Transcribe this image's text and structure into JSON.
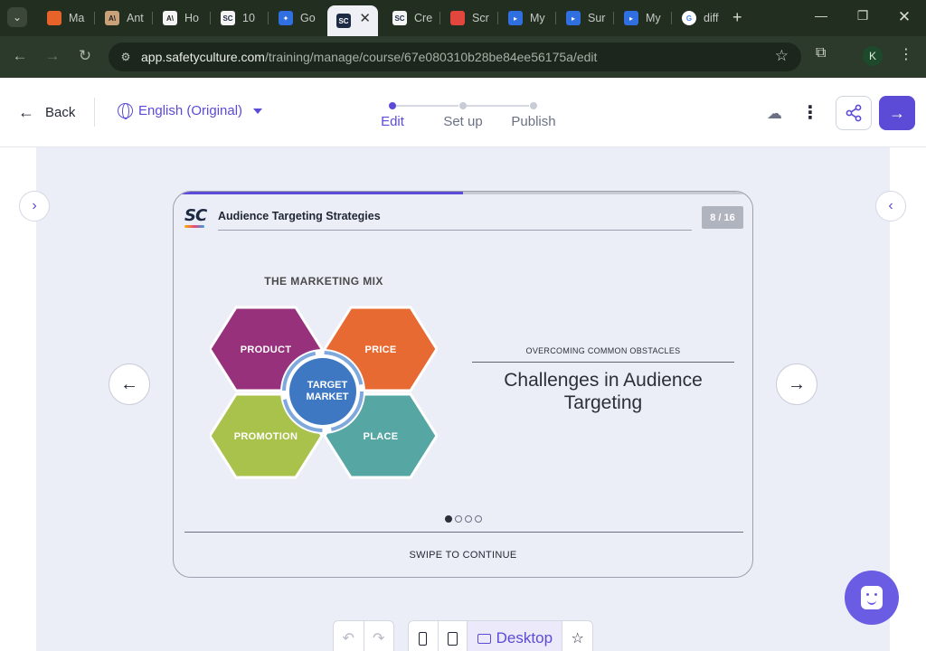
{
  "browser": {
    "tabs": [
      {
        "label": "Ma",
        "favicon": "orange-grid-icon",
        "color": "#e8632a"
      },
      {
        "label": "Ant",
        "favicon": "anthropic-icon",
        "color": "#c9a27a"
      },
      {
        "label": "Ho",
        "favicon": "anthropic-dark-icon",
        "color": "#2b2b2b"
      },
      {
        "label": "10",
        "favicon": "safetyculture-icon",
        "color": "#1c2a44"
      },
      {
        "label": "Go",
        "favicon": "butterfly-icon",
        "color": "#2f6fe0"
      },
      {
        "label": "",
        "favicon": "safetyculture-icon",
        "color": "#1c2a44"
      },
      {
        "label": "Cre",
        "favicon": "safetyculture-icon",
        "color": "#1c2a44"
      },
      {
        "label": "Scr",
        "favicon": "image-icon",
        "color": "#e3463c"
      },
      {
        "label": "My",
        "favicon": "chat-icon",
        "color": "#2f6fe0"
      },
      {
        "label": "Sur",
        "favicon": "chat-icon",
        "color": "#2f6fe0"
      },
      {
        "label": "My",
        "favicon": "chat-icon",
        "color": "#2f6fe0"
      },
      {
        "label": "diff",
        "favicon": "google-icon",
        "color": "#ffffff"
      }
    ],
    "url_host": "app.safetyculture.com",
    "url_path": "/training/manage/course/67e080310b28be84ee56175a/edit",
    "profile_initial": "K"
  },
  "header": {
    "back_label": "Back",
    "language": "English (Original)",
    "steps": [
      {
        "label": "Edit",
        "active": true
      },
      {
        "label": "Set up",
        "active": false
      },
      {
        "label": "Publish",
        "active": false
      }
    ],
    "accent_color": "#5b4bd6"
  },
  "slide": {
    "logo": "SC",
    "course_title": "Audience Targeting Strategies",
    "page": "8 / 16",
    "progress_fraction": 0.5,
    "image": {
      "title": "THE MARKETING MIX",
      "center": [
        "TARGET",
        "MARKET"
      ],
      "segments": [
        {
          "label": "PRODUCT",
          "color": "#97317c"
        },
        {
          "label": "PRICE",
          "color": "#e76a32"
        },
        {
          "label": "PROMOTION",
          "color": "#a9c24c"
        },
        {
          "label": "PLACE",
          "color": "#56a6a4"
        }
      ],
      "center_color": "#3e78c2"
    },
    "kicker": "OVERCOMING COMMON OBSTACLES",
    "heading": "Challenges in Audience Targeting",
    "pager": {
      "total": 4,
      "current": 1
    },
    "swipe_text": "SWIPE TO CONTINUE"
  },
  "bottom_toolbar": {
    "desktop_label": "Desktop"
  }
}
